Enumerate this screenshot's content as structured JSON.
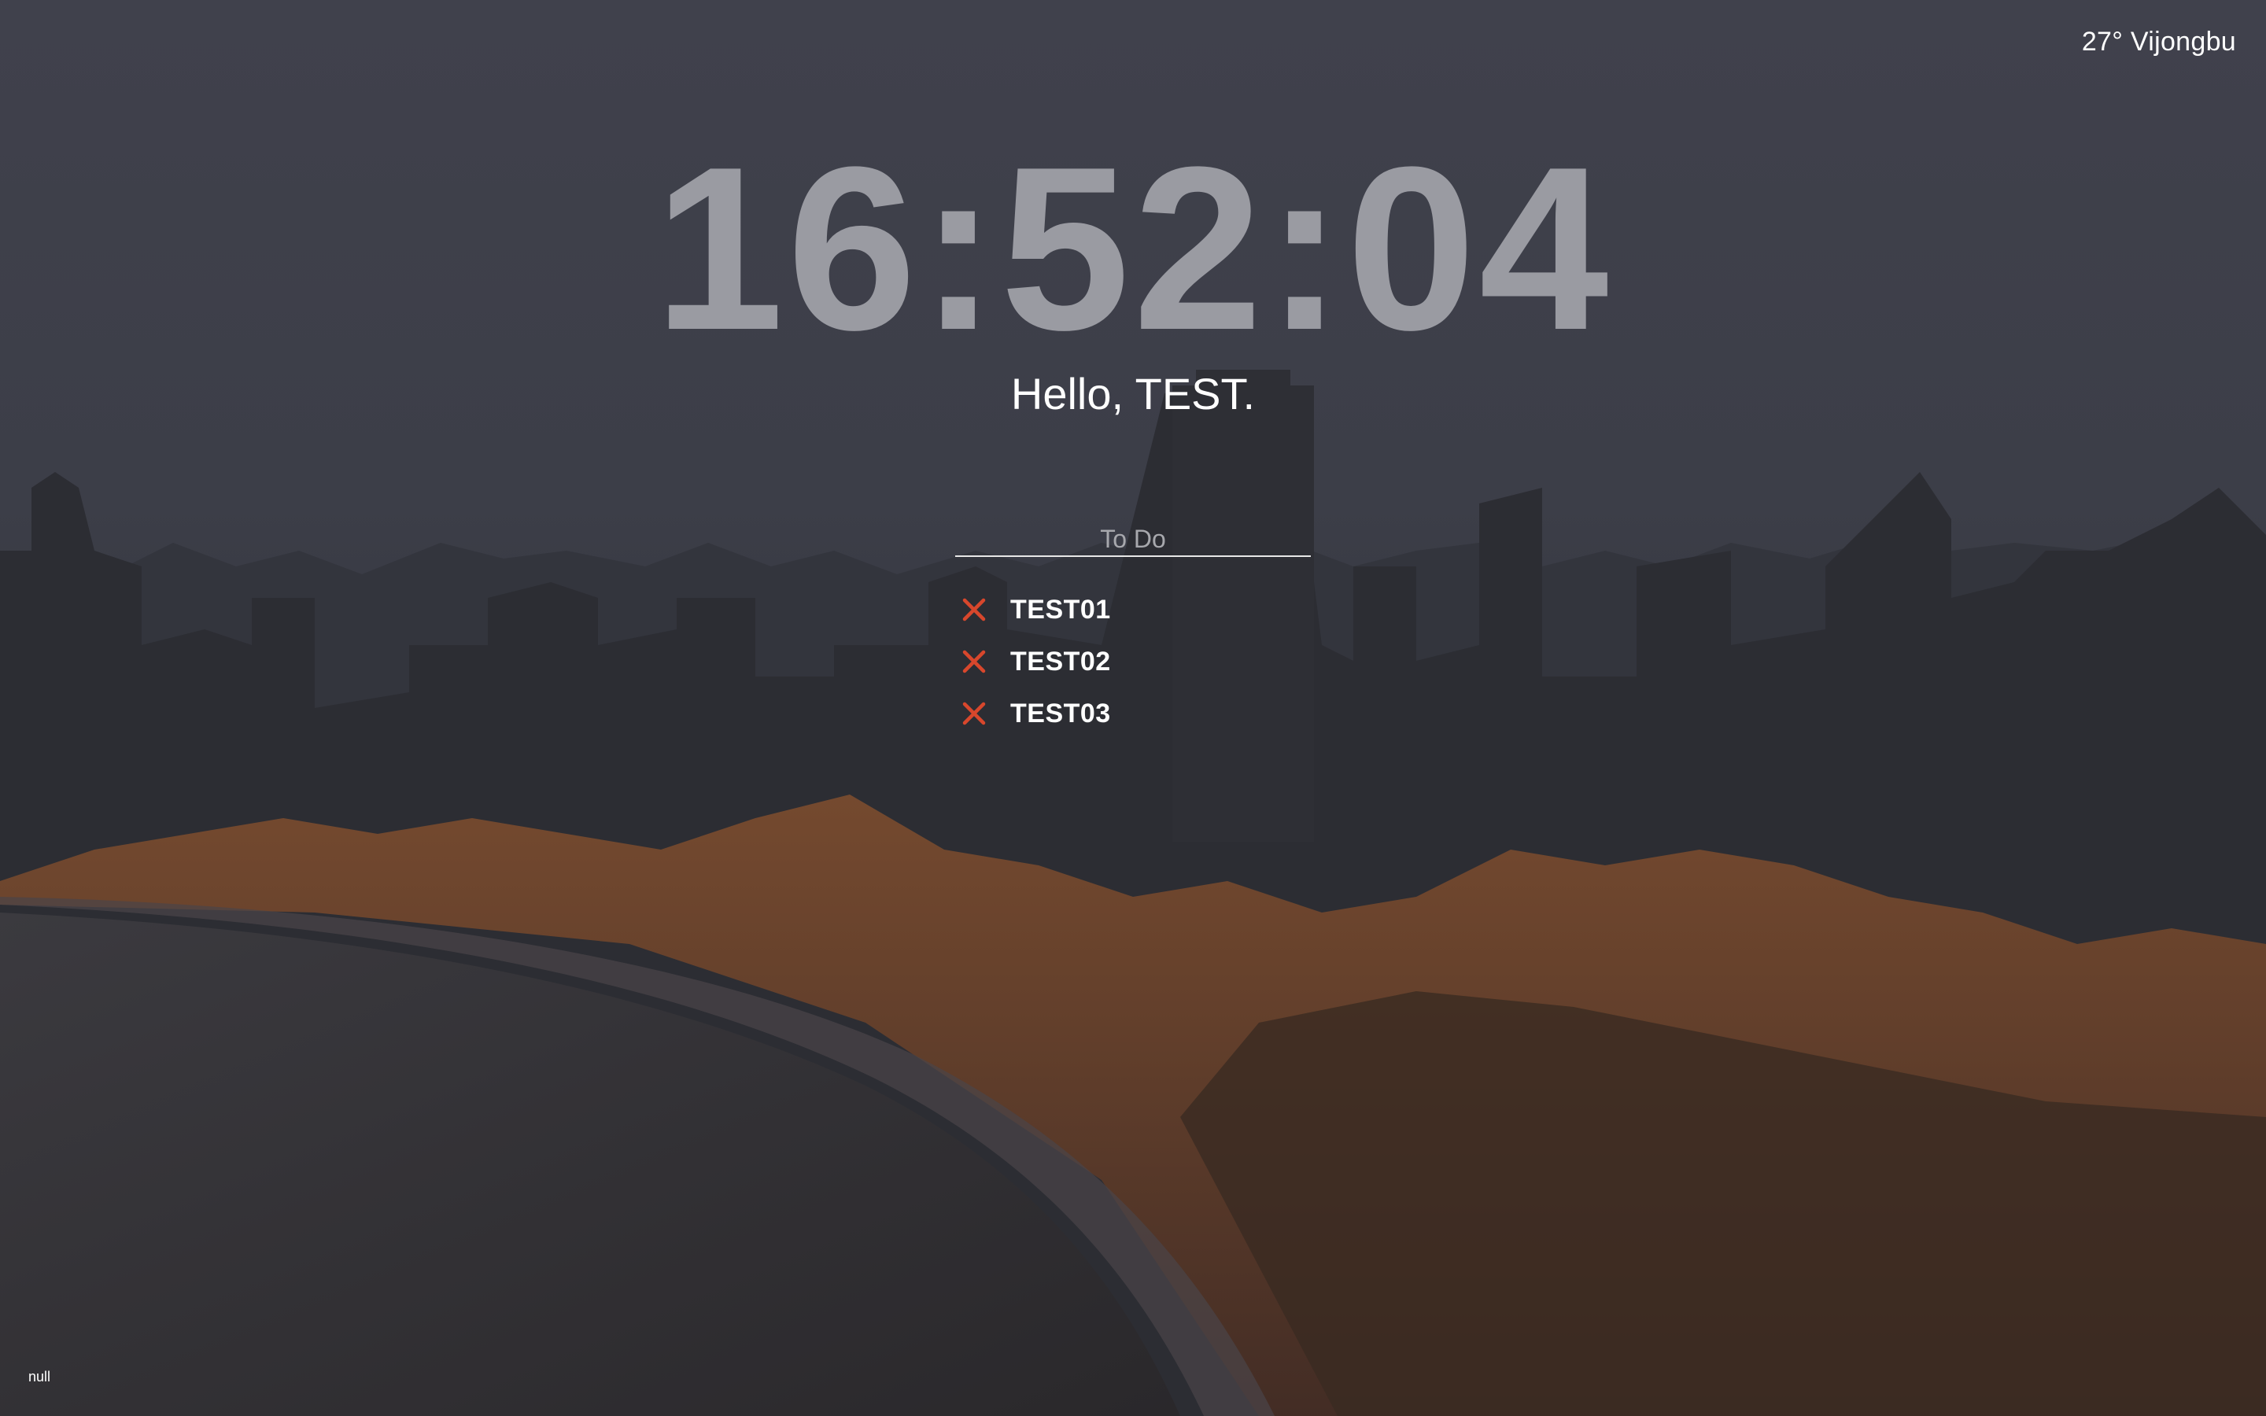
{
  "weather": {
    "text": "27° Vijongbu"
  },
  "clock": {
    "time": "16:52:04"
  },
  "greeting": {
    "text": "Hello, TEST."
  },
  "todo": {
    "placeholder": "To Do",
    "items": [
      {
        "label": "TEST01",
        "delete_icon": "close-x-icon"
      },
      {
        "label": "TEST02",
        "delete_icon": "close-x-icon"
      },
      {
        "label": "TEST03",
        "delete_icon": "close-x-icon"
      }
    ]
  },
  "footer": {
    "quote": "null"
  },
  "colors": {
    "clock": "#9a9ba2",
    "delete_icon": "#d8472c",
    "underline": "#e8e8e8",
    "sky": "#3a3c45"
  },
  "background": {
    "subject": "night-city-skyline-with-river"
  }
}
